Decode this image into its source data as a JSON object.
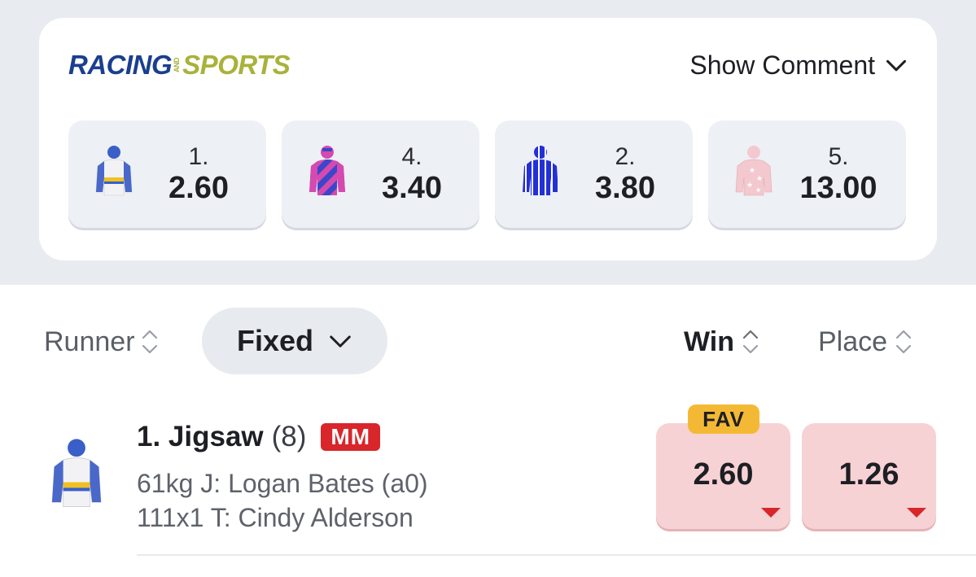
{
  "brand": {
    "logo_left": "RACING",
    "logo_mid": "AND",
    "logo_right": "SPORTS",
    "colors": {
      "navy": "#1a3f8f",
      "olive": "#a9b23a"
    }
  },
  "header": {
    "show_comment": "Show Comment"
  },
  "top_tiles": [
    {
      "number": "1.",
      "odds": "2.60"
    },
    {
      "number": "4.",
      "odds": "3.40"
    },
    {
      "number": "2.",
      "odds": "3.80"
    },
    {
      "number": "5.",
      "odds": "13.00"
    }
  ],
  "columns": {
    "runner": "Runner",
    "fixed": "Fixed",
    "win": "Win",
    "place": "Place"
  },
  "runner": {
    "name": "1. Jigsaw",
    "barrier": "(8)",
    "badge": "MM",
    "line1": "61kg  J: Logan Bates (a0)",
    "line2": "111x1 T: Cindy Alderson",
    "fav": "FAV",
    "win_odds": "2.60",
    "place_odds": "1.26"
  }
}
